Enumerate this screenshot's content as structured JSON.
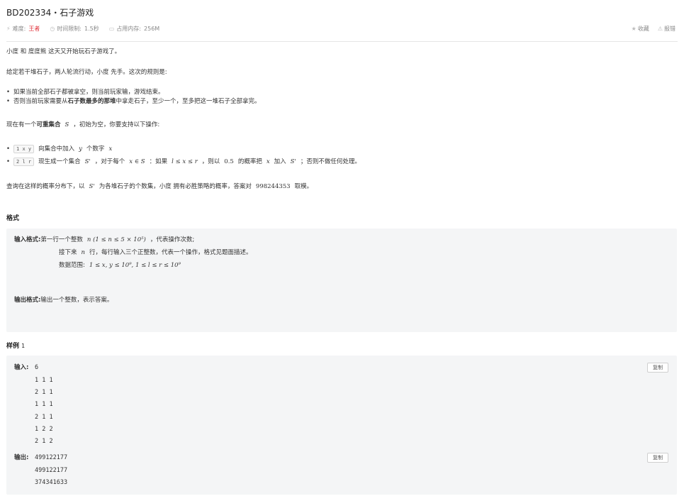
{
  "header": {
    "title": "BD202334・石子游戏",
    "difficulty_label": "难度:",
    "difficulty_value": "王者",
    "time_label": "时间限制:",
    "time_value": "1.5秒",
    "memory_label": "占用内存:",
    "memory_value": "256M",
    "favorite": "收藏",
    "report": "报错"
  },
  "statement": {
    "line1": "小度  和  度度熊  这天又开始玩石子游戏了。",
    "line2": "给定若干堆石子，两人轮流行动，小度  先手。这次的规则是:",
    "bullet1": "如果当前全部石子都被拿空，则当前玩家输，游戏结束。",
    "bullet2_pre": "否则当前玩家需要从",
    "bullet2_bold": "石子数最多的那堆",
    "bullet2_post": "中拿走石子，至少一个，至多把这一堆石子全部拿完。",
    "line3_pre": "现在有一个",
    "line3_bold": "可重集合",
    "line3_sym": "S",
    "line3_post": "，初始为空，你要支持以下操作:",
    "op1_code": "1 x y",
    "op1_pre": "向集合中加入",
    "op1_y": "y",
    "op1_mid": "个数字",
    "op1_x": "x",
    "op2_code": "2 l r",
    "op2_pre": "现生成一个集合",
    "op2_s": "S'",
    "op2_mid1": "，对于每个",
    "op2_cond": "x ∈ S",
    "op2_mid2": "：如果",
    "op2_range": "l ≤ x ≤ r",
    "op2_mid3": "，则以",
    "op2_prob": "0.5",
    "op2_mid4": "的概率把",
    "op2_x": "x",
    "op2_mid5": "加入",
    "op2_s2": "S'",
    "op2_post": "；否则不做任何处理。",
    "query_pre": "查询在这样的概率分布下，以",
    "query_s": "S'",
    "query_mid": "为各堆石子的个数集，小度  拥有必胜策略的概率，答案对",
    "query_mod": "998244353",
    "query_post": "取模。"
  },
  "format": {
    "heading": "格式",
    "input_label": "输入格式:",
    "input_line1_pre": "第一行一个整数",
    "input_line1_math": "n (1 ≤ n ≤ 5 × 10⁵)",
    "input_line1_post": "，代表操作次数;",
    "input_line2_pre": "接下来",
    "input_line2_n": "n",
    "input_line2_post": "行，每行输入三个正整数，代表一个操作，格式见题面描述。",
    "input_line3_pre": "数据范围:",
    "input_line3_math": "1 ≤ x, y ≤ 10⁹, 1 ≤ l ≤ r ≤ 10⁹",
    "output_label": "输出格式:",
    "output_text": "输出一个整数，表示答案。"
  },
  "sample": {
    "heading": "样例",
    "index": "1",
    "input_label": "输入:",
    "input_lines": [
      "6",
      "1 1 1",
      "2 1 1",
      "1 1 1",
      "2 1 1",
      "1 2 2",
      "2 1 2"
    ],
    "output_label": "输出:",
    "output_lines": [
      "499122177",
      "499122177",
      "374341633"
    ],
    "copy_label": "复制"
  }
}
